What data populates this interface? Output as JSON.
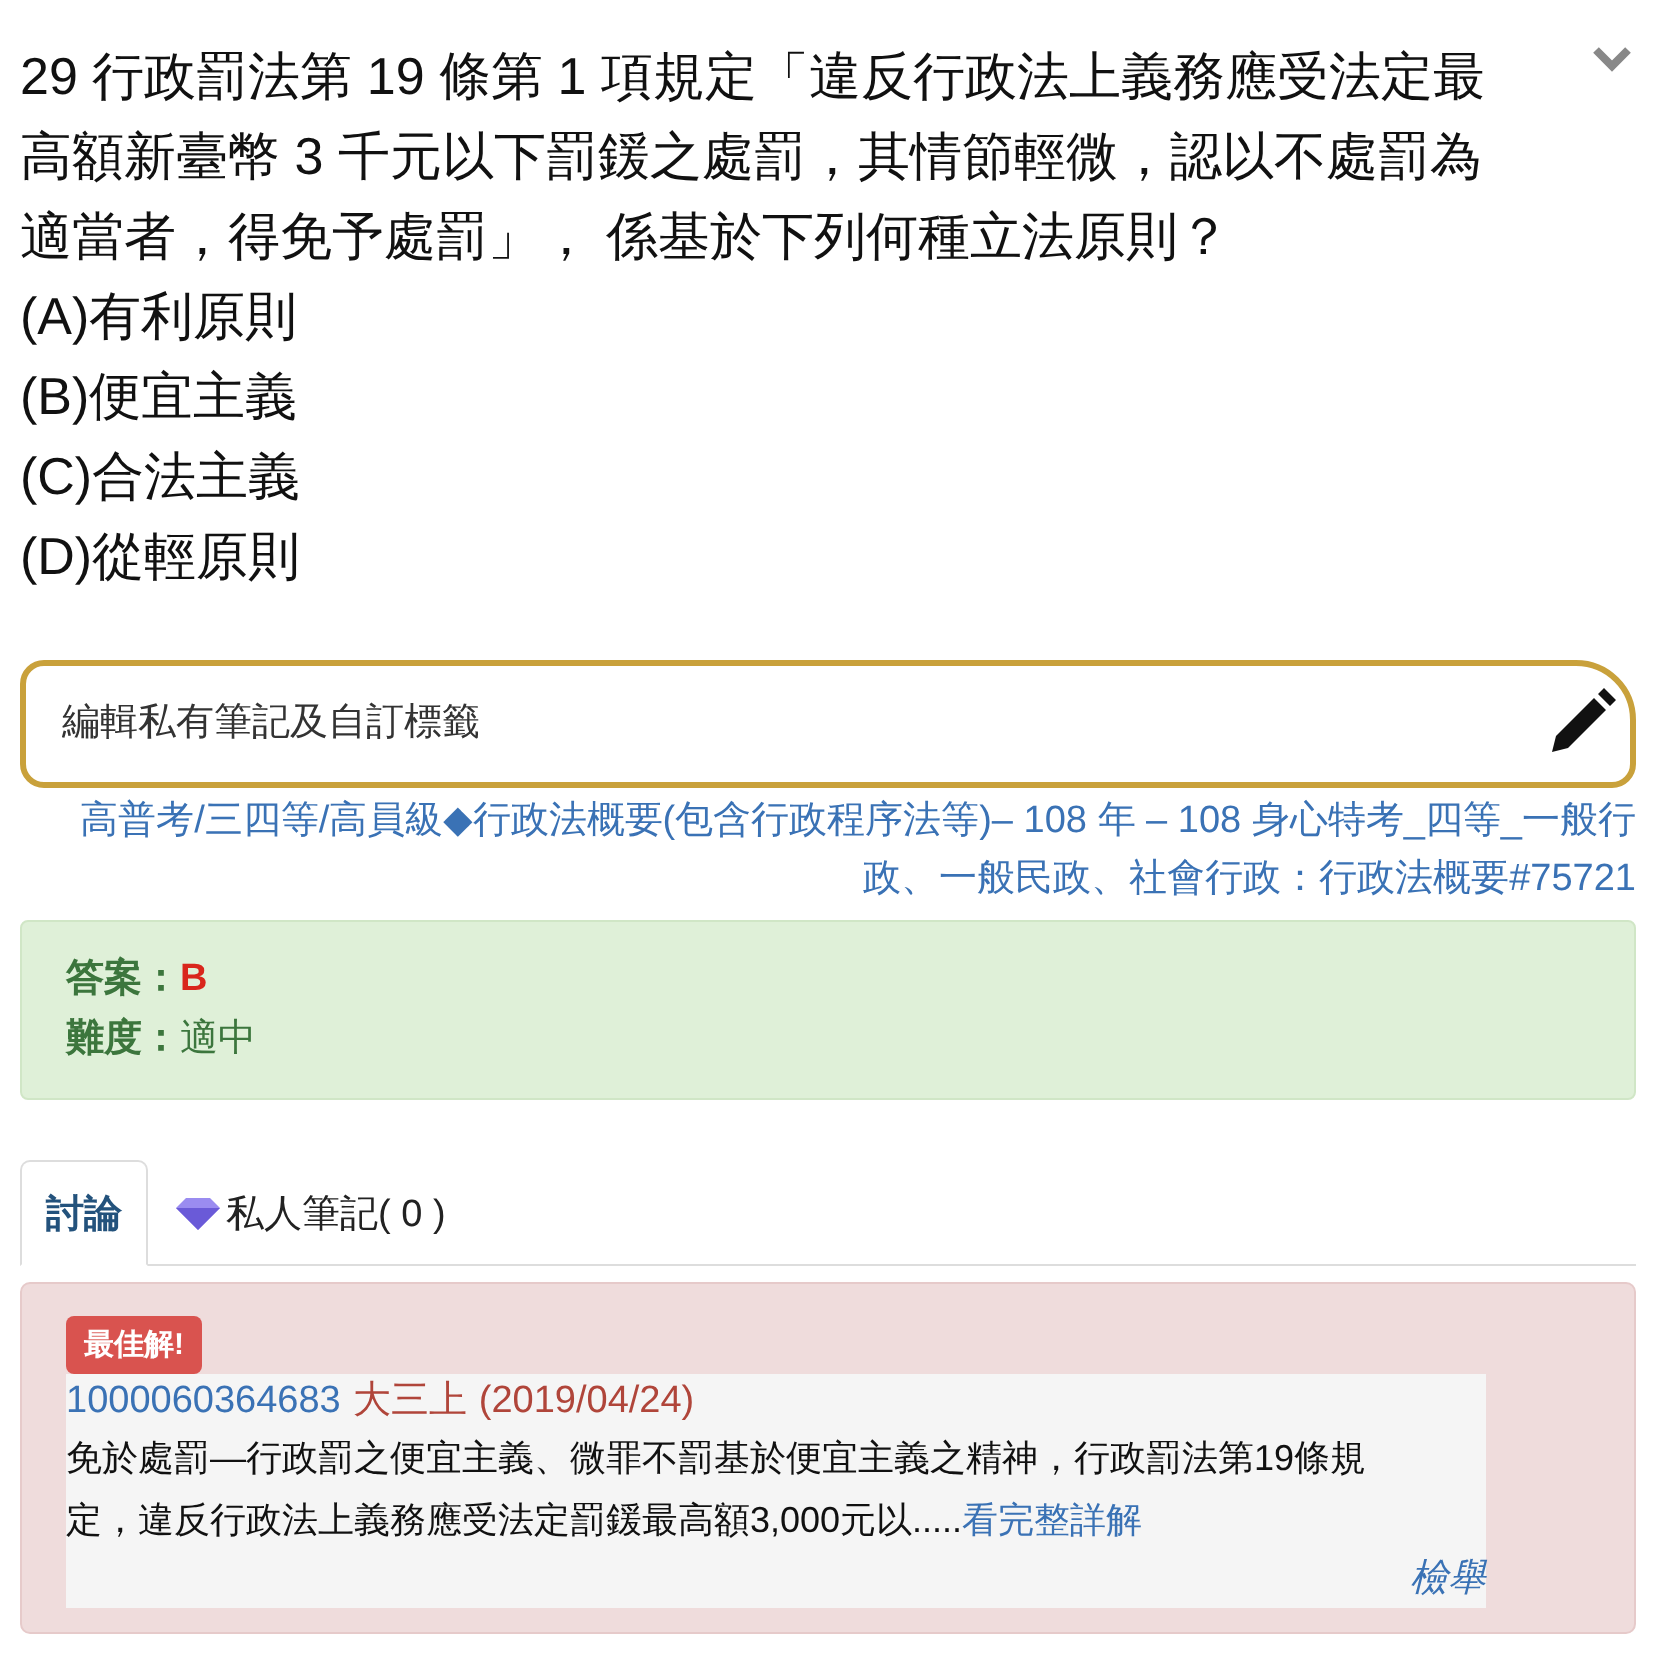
{
  "question": {
    "text": "29 行政罰法第 19 條第 1 項規定「違反行政法上義務應受法定最高額新臺幣 3 千元以下罰鍰之處罰，其情節輕微，認以不處罰為適當者，得免予處罰」， 係基於下列何種立法原則？",
    "options": [
      "(A)有利原則",
      "(B)便宜主義",
      "(C)合法主義",
      "(D)從輕原則"
    ]
  },
  "note_field": {
    "placeholder": "編輯私有筆記及自訂標籤"
  },
  "category_path": "高普考/三四等/高員級◆行政法概要(包含行政程序法等)– 108 年 – 108 身心特考_四等_一般行政、一般民政、社會行政：行政法概要#75721",
  "answer": {
    "label": "答案：",
    "value": "B",
    "difficulty_label": "難度：",
    "difficulty": "適中"
  },
  "tabs": [
    {
      "label": "討論",
      "selected": true,
      "kind": "plain"
    },
    {
      "label": "私人筆記( 0 )",
      "selected": false,
      "kind": "decorated"
    }
  ],
  "discussion": [
    {
      "badge": "最佳解!",
      "user": "1000060364683",
      "rank": "大三上",
      "date": "(2019/04/24)",
      "text": "免於處罰—行政罰之便宜主義、微罪不罰基於便宜主義之精神，行政罰法第19條規定，違反行政法上義務應受法定罰鍰最高額3,000元以.....",
      "more_link": "看完整詳解",
      "report": "檢舉"
    }
  ]
}
